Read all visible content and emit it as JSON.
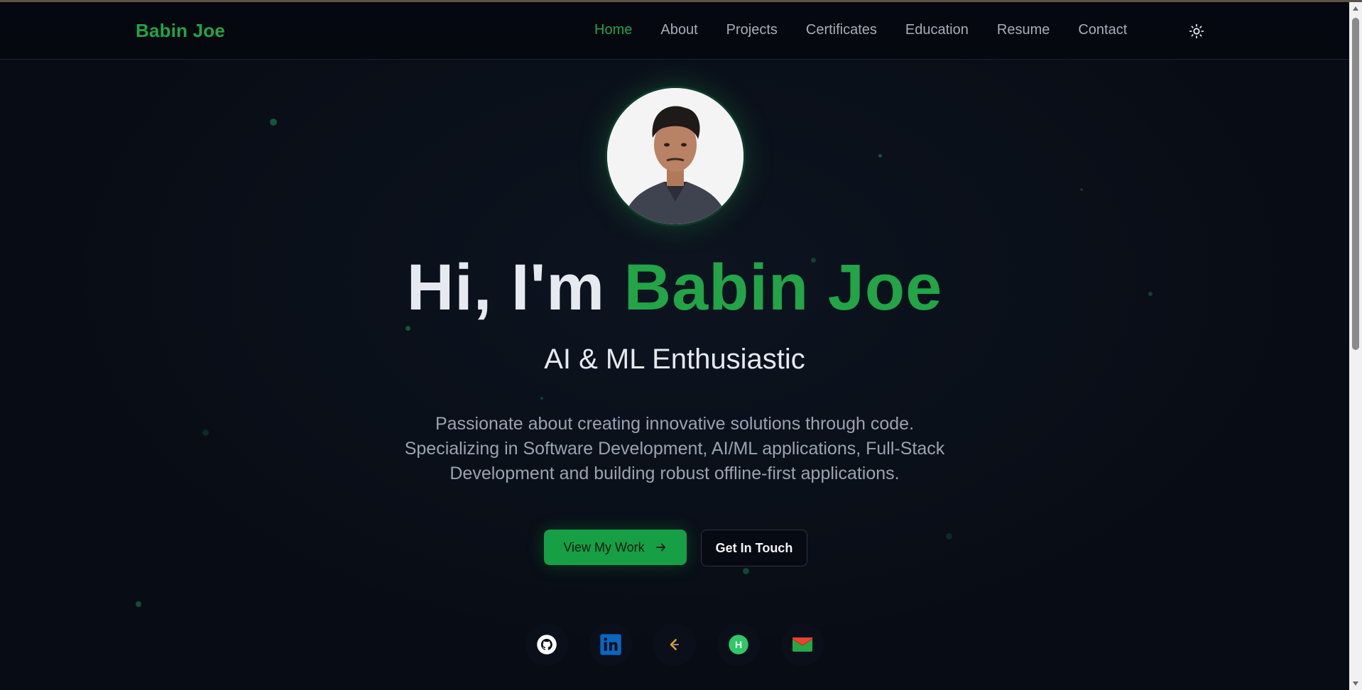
{
  "brand": {
    "name": "Babin Joe"
  },
  "nav": {
    "items": [
      {
        "label": "Home",
        "active": true
      },
      {
        "label": "About",
        "active": false
      },
      {
        "label": "Projects",
        "active": false
      },
      {
        "label": "Certificates",
        "active": false
      },
      {
        "label": "Education",
        "active": false
      },
      {
        "label": "Resume",
        "active": false
      },
      {
        "label": "Contact",
        "active": false
      }
    ],
    "theme_toggle_icon": "sun-icon"
  },
  "hero": {
    "greeting": "Hi, I'm ",
    "name": "Babin Joe",
    "subtitle": "AI & ML Enthusiastic",
    "description_lines": [
      "Passionate about creating innovative solutions through code.",
      "Specializing in Software Development, AI/ML applications, Full-Stack",
      "Development and building robust offline-first applications."
    ],
    "primary_button": "View My Work",
    "secondary_button": "Get In Touch"
  },
  "socials": [
    {
      "icon": "github-icon"
    },
    {
      "icon": "linkedin-icon"
    },
    {
      "icon": "leetcode-icon"
    },
    {
      "icon": "hackerrank-icon",
      "letter": "H"
    },
    {
      "icon": "gmail-icon"
    }
  ],
  "colors": {
    "accent": "#22a447",
    "background": "#090d16",
    "text": "#e6e9ef",
    "muted": "#9ba3b0"
  }
}
